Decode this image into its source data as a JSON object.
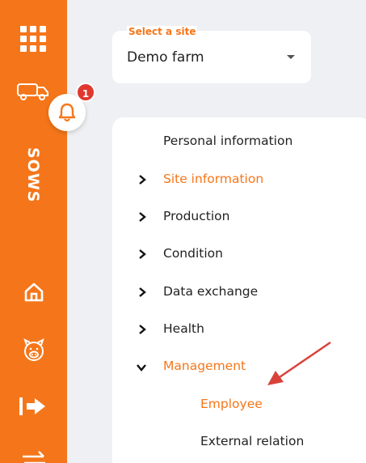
{
  "app": {
    "brand": "SOWS",
    "accent": "#f5761a",
    "notification_count": "1"
  },
  "rail": {
    "icons": [
      "apps-grid-icon",
      "pig-truck-icon",
      "home-icon",
      "pig-face-icon",
      "logout-icon",
      "swap-icon"
    ]
  },
  "site_select": {
    "label": "Select a site",
    "value": "Demo farm"
  },
  "menu": {
    "items": [
      {
        "label": "Personal information",
        "expandable": false,
        "expanded": false,
        "active": false
      },
      {
        "label": "Site information",
        "expandable": true,
        "expanded": false,
        "active": true
      },
      {
        "label": "Production",
        "expandable": true,
        "expanded": false,
        "active": false
      },
      {
        "label": "Condition",
        "expandable": true,
        "expanded": false,
        "active": false
      },
      {
        "label": "Data exchange",
        "expandable": true,
        "expanded": false,
        "active": false
      },
      {
        "label": "Health",
        "expandable": true,
        "expanded": false,
        "active": false
      },
      {
        "label": "Management",
        "expandable": true,
        "expanded": true,
        "active": true
      }
    ],
    "sub_items": [
      {
        "label": "Employee",
        "active": true
      },
      {
        "label": "External relation",
        "active": false
      }
    ]
  }
}
